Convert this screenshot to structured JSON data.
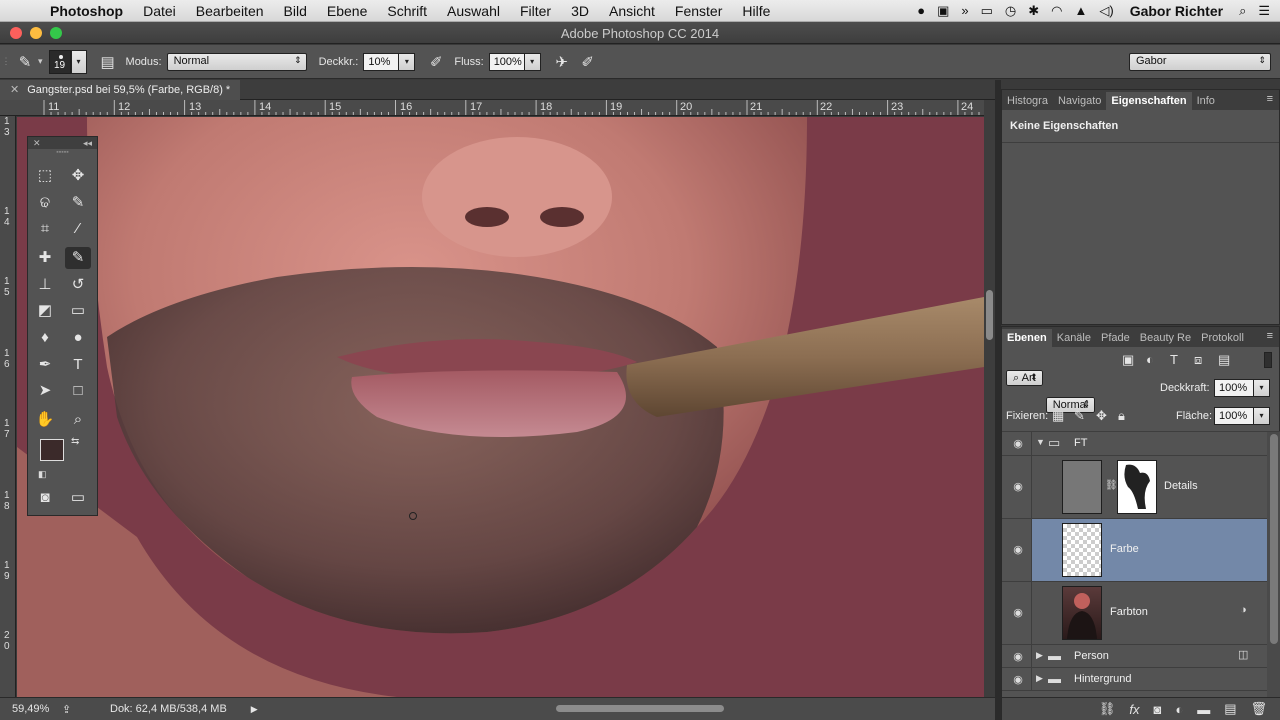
{
  "menubar": {
    "app": "Photoshop",
    "items": [
      "Datei",
      "Bearbeiten",
      "Bild",
      "Ebene",
      "Schrift",
      "Auswahl",
      "Filter",
      "3D",
      "Ansicht",
      "Fenster",
      "Hilfe"
    ],
    "user": "Gabor Richter"
  },
  "window": {
    "title": "Adobe Photoshop CC 2014"
  },
  "options": {
    "brush_size": "19",
    "mode_label": "Modus:",
    "mode_value": "Normal",
    "opacity_label": "Deckkr.:",
    "opacity_value": "10%",
    "flow_label": "Fluss:",
    "flow_value": "100%",
    "workspace": "Gabor"
  },
  "document": {
    "tab_title": "Gangster.psd bei 59,5% (Farbe, RGB/8) *",
    "zoom": "59,49%",
    "doc_info": "Dok: 62,4 MB/538,4 MB"
  },
  "rulers": {
    "top": [
      "11",
      "12",
      "13",
      "14",
      "15",
      "16",
      "17",
      "18",
      "19",
      "20",
      "21",
      "22",
      "23",
      "24"
    ],
    "left": [
      "1\n3",
      "1\n4",
      "1\n5",
      "1\n6",
      "1\n7",
      "1\n8",
      "1\n9",
      "2\n0"
    ]
  },
  "properties": {
    "tabs": [
      "Histogra",
      "Navigato",
      "Eigenschaften",
      "Info"
    ],
    "active_tab": "Eigenschaften",
    "empty_text": "Keine Eigenschaften"
  },
  "layers_panel": {
    "tabs": [
      "Ebenen",
      "Kanäle",
      "Pfade",
      "Beauty Re",
      "Protokoll"
    ],
    "filter_value": "Art",
    "blend_mode": "Normal",
    "opacity_label": "Deckkraft:",
    "opacity_value": "100%",
    "lock_label": "Fixieren:",
    "fill_label": "Fläche:",
    "fill_value": "100%",
    "layers": [
      {
        "name": "FT"
      },
      {
        "name": "Details"
      },
      {
        "name": "Farbe"
      },
      {
        "name": "Farbton"
      },
      {
        "name": "Person"
      },
      {
        "name": "Hintergrund"
      }
    ]
  },
  "colors": {
    "selected_layer": "#7388a8",
    "foreground": "#3b2a2a",
    "background": "#cfd4bb",
    "canvas_bg": "#7a3b48"
  }
}
